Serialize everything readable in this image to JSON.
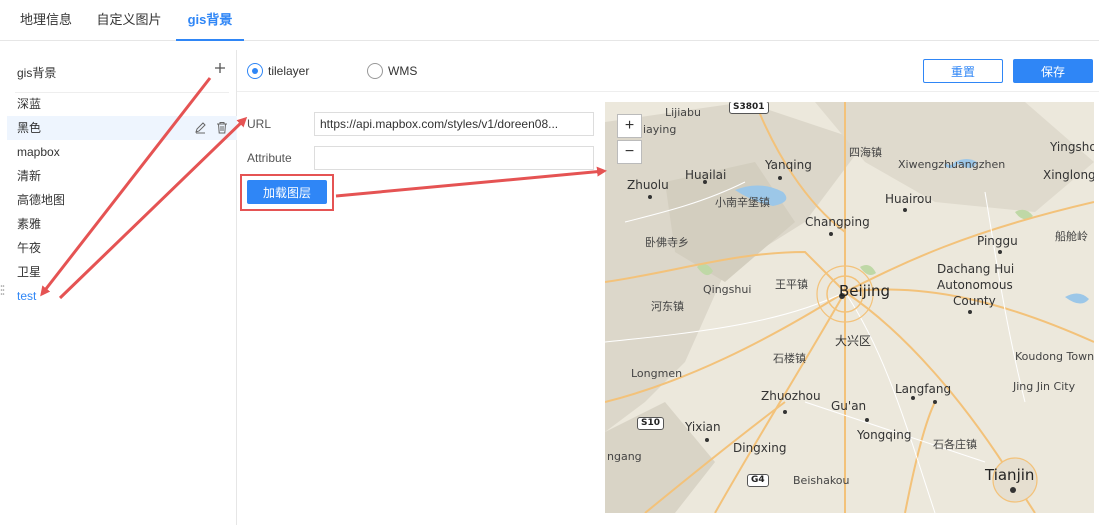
{
  "tabs": [
    {
      "label": "地理信息"
    },
    {
      "label": "自定义图片"
    },
    {
      "label": "gis背景"
    }
  ],
  "sidebar": {
    "title": "gis背景",
    "items": [
      {
        "label": "深蓝"
      },
      {
        "label": "黑色"
      },
      {
        "label": "mapbox"
      },
      {
        "label": "清新"
      },
      {
        "label": "高德地图"
      },
      {
        "label": "素雅"
      },
      {
        "label": "午夜"
      },
      {
        "label": "卫星"
      },
      {
        "label": "test"
      }
    ]
  },
  "radio": {
    "option1": "tilelayer",
    "option2": "WMS",
    "selected": "tilelayer"
  },
  "toolbar": {
    "reset_label": "重置",
    "save_label": "保存"
  },
  "form": {
    "url_label": "URL",
    "url_value": "https://api.mapbox.com/styles/v1/doreen08...",
    "attribute_label": "Attribute",
    "attribute_value": "",
    "load_label": "加载图层"
  },
  "map": {
    "zoom_in": "+",
    "zoom_out": "−",
    "labels": {
      "lijiabu": "Lijiabu",
      "s3801": "S3801",
      "iaying": "iaying",
      "sihaizhen": "四海镇",
      "yingsho": "Yingsho",
      "huailai": "Huailai",
      "yanqing": "Yanqing",
      "xiwengzhuang": "Xiwengzhuangzhen",
      "zhuolu": "Zhuolu",
      "xinanbao": "小南辛堡镇",
      "huairou": "Huairou",
      "xinglong": "Xinglong",
      "changping": "Changping",
      "wofosi": "卧佛寺乡",
      "pinggu": "Pinggu",
      "chuanling": "船舱岭",
      "wangping": "王平镇",
      "qingshui": "Qingshui",
      "beijing": "Beijing",
      "dachang": "Dachang Hui",
      "autonomous": "Autonomous",
      "county": "County",
      "hedong": "河东镇",
      "daxing": "大兴区",
      "shilou": "石楼镇",
      "koudong": "Koudong Town",
      "longmen": "Longmen",
      "langfang": "Langfang",
      "jingjin": "Jing Jin City",
      "zhuozhou": "Zhuozhou",
      "guan": "Gu'an",
      "s10": "S10",
      "yixian": "Yixian",
      "yongqing": "Yongqing",
      "shigezhuang": "石各庄镇",
      "dingxing": "Dingxing",
      "ngang": "ngang",
      "g4": "G4",
      "beishakou": "Beishakou",
      "tianjin": "Tianjin"
    }
  },
  "colors": {
    "accent": "#2f86f6",
    "annotation": "#e55353"
  }
}
